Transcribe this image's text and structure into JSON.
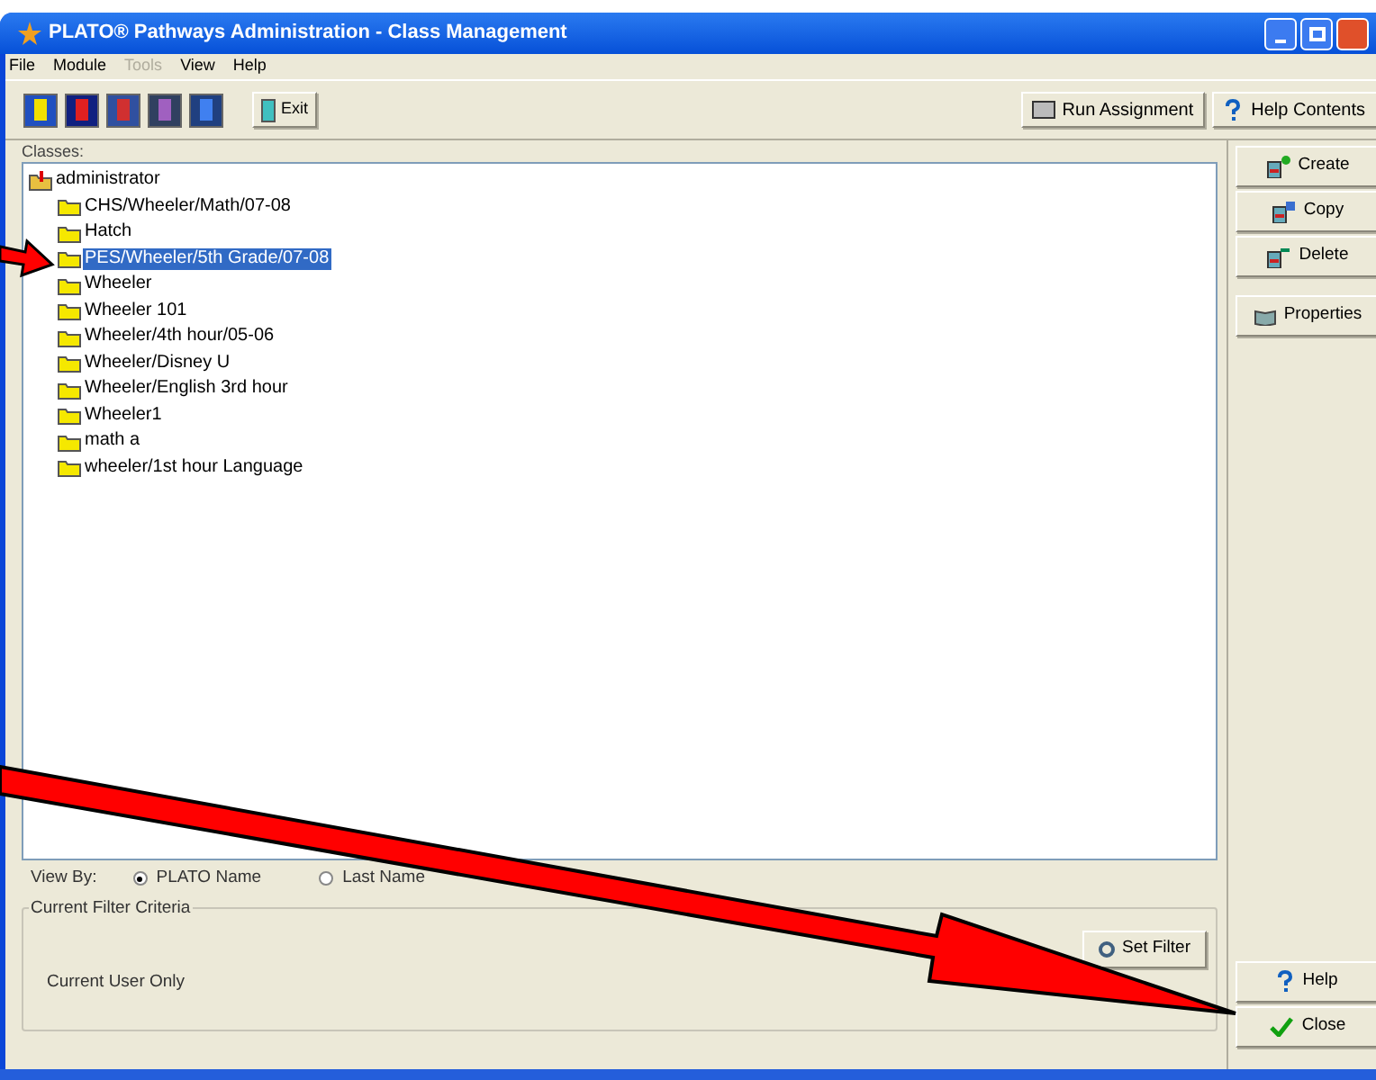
{
  "window": {
    "title": "PLATO® Pathways Administration - Class Management"
  },
  "menu": [
    {
      "label": "File",
      "disabled": false
    },
    {
      "label": "Module",
      "disabled": false
    },
    {
      "label": "Tools",
      "disabled": true
    },
    {
      "label": "View",
      "disabled": false
    },
    {
      "label": "Help",
      "disabled": false
    }
  ],
  "toolbar": {
    "exit": "Exit",
    "run_assignment": "Run Assignment",
    "help_contents": "Help Contents"
  },
  "classes": {
    "label": "Classes:",
    "tree": [
      {
        "label": "administrator",
        "selected": false,
        "children": [
          {
            "label": "CHS/Wheeler/Math/07-08",
            "selected": false
          },
          {
            "label": "Hatch",
            "selected": false
          },
          {
            "label": "PES/Wheeler/5th Grade/07-08",
            "selected": true
          },
          {
            "label": "Wheeler",
            "selected": false
          },
          {
            "label": "Wheeler 101",
            "selected": false
          },
          {
            "label": "Wheeler/4th hour/05-06",
            "selected": false
          },
          {
            "label": "Wheeler/Disney U",
            "selected": false
          },
          {
            "label": "Wheeler/English 3rd hour",
            "selected": false
          },
          {
            "label": "Wheeler1",
            "selected": false
          },
          {
            "label": "math a",
            "selected": false
          },
          {
            "label": "wheeler/1st hour Language",
            "selected": false
          }
        ]
      }
    ]
  },
  "view_by": {
    "label": "View By:",
    "options": [
      {
        "label": "PLATO Name",
        "selected": true
      },
      {
        "label": "Last Name",
        "selected": false
      }
    ]
  },
  "filter": {
    "title": "Current Filter Criteria",
    "value": "Current User Only",
    "button": "Set Filter"
  },
  "side_buttons": [
    "Create",
    "Copy",
    "Delete",
    "Properties"
  ],
  "bottom_buttons": [
    {
      "label": "Help",
      "kind": "help"
    },
    {
      "label": "Close",
      "kind": "close"
    }
  ]
}
